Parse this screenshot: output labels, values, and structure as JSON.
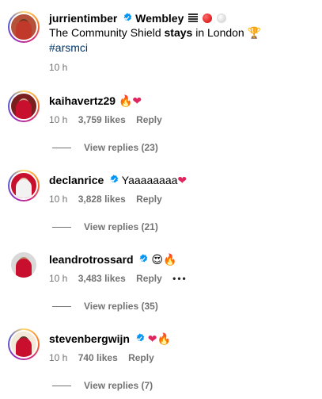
{
  "post": {
    "username": "jurrientimber",
    "caption_bold_start": "Wembley",
    "caption_line2_a": "The Community Shield ",
    "caption_line2_b": "stays",
    "caption_line2_c": " in London",
    "hashtag": "#arsmci",
    "time": "10 h"
  },
  "comments": [
    {
      "username": "kaihavertz29",
      "verified": true,
      "text": "",
      "time": "10 h",
      "likes": "3,759 likes",
      "reply": "Reply",
      "view_replies": "View replies (23)"
    },
    {
      "username": "declanrice",
      "verified": true,
      "text": "Yaaaaaaaa",
      "time": "10 h",
      "likes": "3,828 likes",
      "reply": "Reply",
      "view_replies": "View replies (21)"
    },
    {
      "username": "leandrotrossard",
      "verified": true,
      "text": "",
      "time": "10 h",
      "likes": "3,483 likes",
      "reply": "Reply",
      "more": "•••",
      "view_replies": "View replies (35)"
    },
    {
      "username": "stevenbergwijn",
      "verified": true,
      "text": "",
      "time": "10 h",
      "likes": "740 likes",
      "reply": "Reply",
      "view_replies": "View replies (7)"
    }
  ],
  "emojis": {
    "fire": "🔥",
    "heart": "❤",
    "trophy": "🏆",
    "heart_eyes": "😍"
  },
  "colors": {
    "verified_blue": "#0095f6",
    "meta_gray": "#737373",
    "hashtag_blue": "#00376b"
  }
}
